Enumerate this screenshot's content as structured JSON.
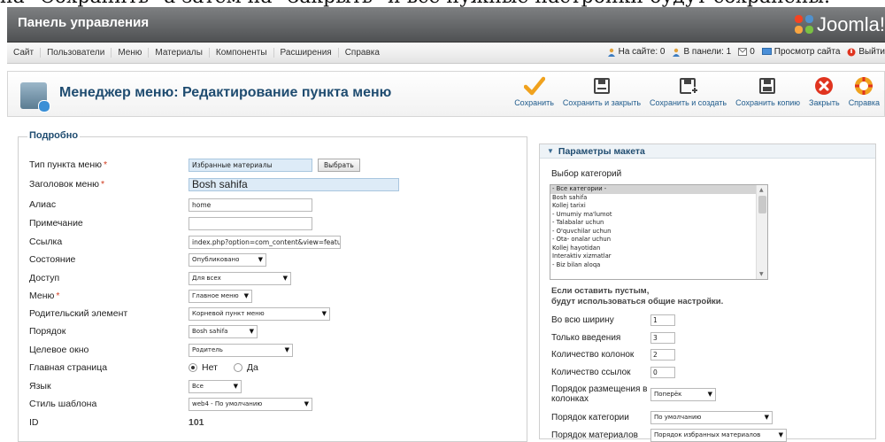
{
  "top_strip_text": "на \"Сохранить\" а затем на \"Закрыть\" и все нужные настройки будут сохранены.",
  "header": {
    "title": "Панель управления",
    "logo_text": "Joomla!"
  },
  "menubar": {
    "items": [
      "Сайт",
      "Пользователи",
      "Меню",
      "Материалы",
      "Компоненты",
      "Расширения",
      "Справка"
    ],
    "status": {
      "on_site": "На сайте: 0",
      "in_panel": "В панели: 1",
      "messages": "0",
      "preview": "Просмотр сайта",
      "logout": "Выйти"
    }
  },
  "toolbar": {
    "title": "Менеджер меню: Редактирование пункта меню",
    "buttons": [
      {
        "label": "Сохранить",
        "icon": "checkmark-icon"
      },
      {
        "label": "Сохранить и закрыть",
        "icon": "save-icon"
      },
      {
        "label": "Сохранить и создать",
        "icon": "save-new-icon"
      },
      {
        "label": "Сохранить копию",
        "icon": "save-copy-icon"
      },
      {
        "label": "Закрыть",
        "icon": "close-icon"
      },
      {
        "label": "Справка",
        "icon": "help-icon"
      }
    ]
  },
  "details": {
    "legend": "Подробно",
    "menu_item_type": {
      "label": "Тип пункта меню",
      "value": "Избранные материалы",
      "button": "Выбрать"
    },
    "menu_title": {
      "label": "Заголовок меню",
      "value": "Bosh sahifa"
    },
    "alias": {
      "label": "Алиас",
      "value": "home"
    },
    "note": {
      "label": "Примечание",
      "value": ""
    },
    "link": {
      "label": "Ссылка",
      "value": "index.php?option=com_content&view=featured"
    },
    "state": {
      "label": "Состояние",
      "value": "Опубликовано"
    },
    "access": {
      "label": "Доступ",
      "value": "Для всех"
    },
    "menu": {
      "label": "Меню",
      "value": "Главное меню"
    },
    "parent": {
      "label": "Родительский элемент",
      "value": "Корневой пункт меню"
    },
    "ordering": {
      "label": "Порядок",
      "value": "Bosh sahifa"
    },
    "target": {
      "label": "Целевое окно",
      "value": "Родитель"
    },
    "home": {
      "label": "Главная страница",
      "no": "Нет",
      "yes": "Да",
      "selected": "Нет"
    },
    "language": {
      "label": "Язык",
      "value": "Все"
    },
    "template_style": {
      "label": "Стиль шаблона",
      "value": "web4 - По умолчанию"
    },
    "id": {
      "label": "ID",
      "value": "101"
    }
  },
  "layout_params": {
    "title": "Параметры макета",
    "category_label": "Выбор категорий",
    "categories": [
      "- Все категории -",
      "Bosh sahifa",
      "Kollej tarixi",
      "- Umumiy ma'lumot",
      "- Talabalar uchun",
      "- O'quvchilar uchun",
      "- Ota- onalar uchun",
      "Kollej hayotidan",
      "Interaktiv xizmatlar",
      "- Biz bilan aloqa"
    ],
    "selected_category": "- Все категории -",
    "note": "Если оставить пустым,\nбудут использоваться общие настройки.",
    "fields": {
      "full_width": {
        "label": "Во всю ширину",
        "value": "1"
      },
      "intro_only": {
        "label": "Только введения",
        "value": "3"
      },
      "columns": {
        "label": "Количество колонок",
        "value": "2"
      },
      "links": {
        "label": "Количество ссылок",
        "value": "0"
      },
      "multi_column_order": {
        "label": "Порядок размещения в колонках",
        "value": "Поперёк"
      },
      "category_order": {
        "label": "Порядок категории",
        "value": "По умолчанию"
      },
      "article_order": {
        "label": "Порядок материалов",
        "value": "Порядок избранных материалов"
      }
    }
  }
}
